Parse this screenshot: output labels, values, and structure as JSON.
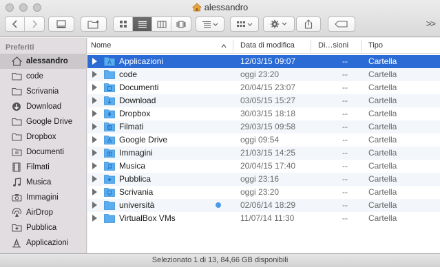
{
  "window": {
    "title": "alessandro"
  },
  "toolbar": {
    "back_label": "<",
    "forward_label": ">",
    "more_label": ">>"
  },
  "sidebar": {
    "heading": "Preferiti",
    "items": [
      {
        "label": "alessandro",
        "icon": "home-icon",
        "selected": true
      },
      {
        "label": "code",
        "icon": "folder-icon"
      },
      {
        "label": "Scrivania",
        "icon": "folder-icon"
      },
      {
        "label": "Download",
        "icon": "download-icon"
      },
      {
        "label": "Google Drive",
        "icon": "folder-icon"
      },
      {
        "label": "Dropbox",
        "icon": "folder-icon"
      },
      {
        "label": "Documenti",
        "icon": "documents-icon"
      },
      {
        "label": "Filmati",
        "icon": "film-icon"
      },
      {
        "label": "Musica",
        "icon": "music-icon"
      },
      {
        "label": "Immagini",
        "icon": "camera-icon"
      },
      {
        "label": "AirDrop",
        "icon": "airdrop-icon"
      },
      {
        "label": "Pubblica",
        "icon": "public-icon"
      },
      {
        "label": "Applicazioni",
        "icon": "applications-icon"
      }
    ]
  },
  "columns": {
    "name": "Nome",
    "date": "Data di modifica",
    "size": "Di…sioni",
    "kind": "Tipo"
  },
  "files": [
    {
      "name": "Applicazioni",
      "date": "12/03/15 09:07",
      "size": "--",
      "kind": "Cartella",
      "selected": true
    },
    {
      "name": "code",
      "date": "oggi 23:20",
      "size": "--",
      "kind": "Cartella"
    },
    {
      "name": "Documenti",
      "date": "20/04/15 23:07",
      "size": "--",
      "kind": "Cartella"
    },
    {
      "name": "Download",
      "date": "03/05/15 15:27",
      "size": "--",
      "kind": "Cartella"
    },
    {
      "name": "Dropbox",
      "date": "30/03/15 18:18",
      "size": "--",
      "kind": "Cartella"
    },
    {
      "name": "Filmati",
      "date": "29/03/15 09:58",
      "size": "--",
      "kind": "Cartella"
    },
    {
      "name": "Google Drive",
      "date": "oggi 09:54",
      "size": "--",
      "kind": "Cartella"
    },
    {
      "name": "Immagini",
      "date": "21/03/15 14:25",
      "size": "--",
      "kind": "Cartella"
    },
    {
      "name": "Musica",
      "date": "20/04/15 17:40",
      "size": "--",
      "kind": "Cartella"
    },
    {
      "name": "Pubblica",
      "date": "oggi 23:16",
      "size": "--",
      "kind": "Cartella"
    },
    {
      "name": "Scrivania",
      "date": "oggi 23:20",
      "size": "--",
      "kind": "Cartella"
    },
    {
      "name": "università",
      "date": "02/06/14 18:29",
      "size": "--",
      "kind": "Cartella",
      "tag_color": "#4a9be8"
    },
    {
      "name": "VirtualBox VMs",
      "date": "11/07/14 11:30",
      "size": "--",
      "kind": "Cartella"
    }
  ],
  "status": {
    "text": "Selezionato 1 di 13, 84,66 GB disponibili"
  },
  "colors": {
    "selection": "#2a6bd6",
    "folder": "#5aaef0",
    "tag": "#4a9be8"
  }
}
